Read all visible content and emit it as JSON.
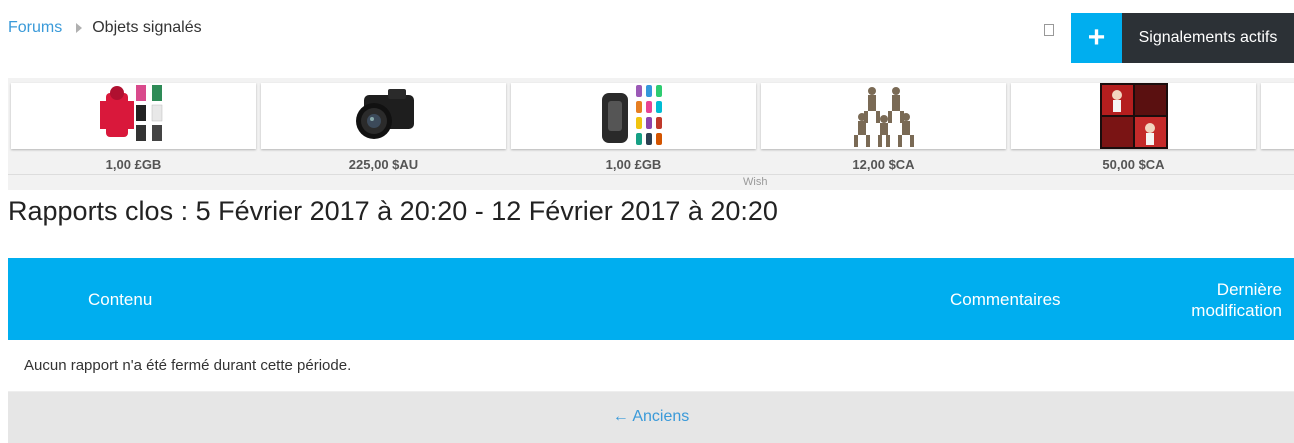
{
  "breadcrumb": {
    "root": "Forums",
    "current": "Objets signalés"
  },
  "header": {
    "plus_icon": "+",
    "active_reports_label": "Signalements actifs"
  },
  "ads": {
    "items": [
      {
        "price": "1,00 £GB",
        "image": "hoodies-image"
      },
      {
        "price": "225,00 $AU",
        "image": "camera-image"
      },
      {
        "price": "1,00 £GB",
        "image": "fitness-band-image"
      },
      {
        "price": "12,00 $CA",
        "image": "figurines-image"
      },
      {
        "price": "50,00 $CA",
        "image": "photo-collage-image"
      }
    ],
    "source": "Wish"
  },
  "page": {
    "title": "Rapports clos : 5 Février 2017 à 20:20 - 12 Février 2017 à 20:20"
  },
  "table": {
    "col_content": "Contenu",
    "col_comments": "Commentaires",
    "col_modified_line1": "Dernière",
    "col_modified_line2": "modification",
    "empty_message": "Aucun rapport n'a été fermé durant cette période."
  },
  "pager": {
    "older_label": "← Anciens"
  },
  "colors": {
    "accent": "#00aeef",
    "dark": "#2c3136",
    "link": "#3a9ad9"
  }
}
